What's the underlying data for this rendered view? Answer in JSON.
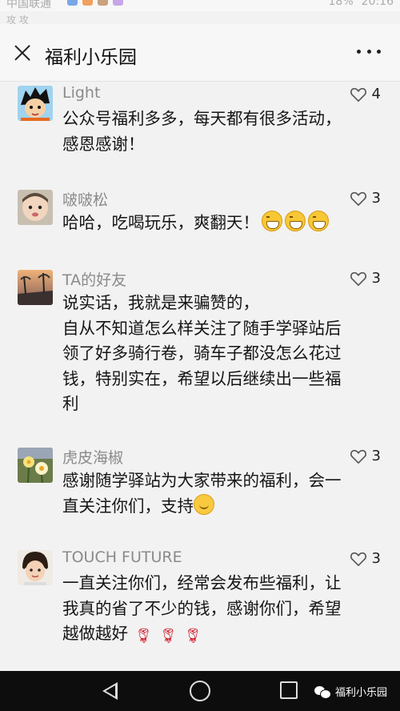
{
  "status": {
    "carrier": "中国联通",
    "battery": "18%",
    "time": "20:16",
    "sub": "攻  攻"
  },
  "header": {
    "title": "福利小乐园"
  },
  "comments": [
    {
      "nickname": "Light",
      "likes": "4",
      "text": "公众号福利多多，每天都有很多活动，\n感恩感谢！",
      "avatar": "anime-boy"
    },
    {
      "nickname": "啵啵松",
      "likes": "3",
      "text": "哈哈，吃喝玩乐，爽翻天！",
      "trailing_emoji": "grinning-face-emoji x3",
      "avatar": "baby-photo"
    },
    {
      "nickname": "TA的好友",
      "likes": "3",
      "text": "说实话，我就是来骗赞的，\n自从不知道怎么样关注了随手学驿站后\n领了好多骑行卷，骑车子都没怎么花过\n钱，特别实在，希望以后继续出一些福\n利",
      "avatar": "sunset-street-photo"
    },
    {
      "nickname": "虎皮海椒",
      "likes": "3",
      "text": "感谢随学驿站为大家带来的福利，会一\n直关注你们，支持",
      "trailing_emoji": "smiling-face-emoji",
      "avatar": "daffodil-flowers"
    },
    {
      "nickname": "TOUCH FUTURE",
      "likes": "3",
      "text": "一直关注你们，经常会发布些福利，让\n我真的省了不少的钱，感谢你们，希望\n越做越好",
      "trailing_emoji": "rose-emoji x3",
      "avatar": "child-portrait"
    }
  ],
  "navbar": {
    "watermark": "福利小乐园"
  },
  "colors": {
    "background": "#f2f2f2",
    "header": "#f7f7f7",
    "nickname": "#8a8a8a",
    "navbar": "#0d0d0d"
  }
}
